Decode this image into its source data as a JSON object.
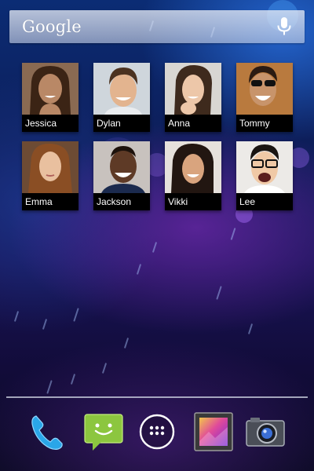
{
  "search": {
    "logo_text": "Google",
    "mic_icon": "microphone-icon"
  },
  "contacts": [
    {
      "name": "Jessica",
      "skin": "#b98866",
      "hair": "#3b2415",
      "bg": "#8a6a52"
    },
    {
      "name": "Dylan",
      "skin": "#e3b48f",
      "hair": "#4b3220",
      "bg": "#cfd6dc"
    },
    {
      "name": "Anna",
      "skin": "#edc7a9",
      "hair": "#3e2a1d",
      "bg": "#d8d6d2"
    },
    {
      "name": "Tommy",
      "skin": "#c8946b",
      "hair": "#2b1b12",
      "bg": "#b97a3e"
    },
    {
      "name": "Emma",
      "skin": "#e9c09f",
      "hair": "#8a4e24",
      "bg": "#6d4b34"
    },
    {
      "name": "Jackson",
      "skin": "#5e3a26",
      "hair": "#1d120c",
      "bg": "#c8c2be"
    },
    {
      "name": "Vikki",
      "skin": "#d9a47e",
      "hair": "#221611",
      "bg": "#e6e1dc"
    },
    {
      "name": "Lee",
      "skin": "#f0c9a6",
      "hair": "#1a1512",
      "bg": "#eceae7"
    }
  ],
  "dock": [
    {
      "name": "phone",
      "icon": "phone-icon"
    },
    {
      "name": "messaging",
      "icon": "messaging-icon"
    },
    {
      "name": "all-apps",
      "icon": "app-drawer-icon"
    },
    {
      "name": "gallery",
      "icon": "gallery-icon"
    },
    {
      "name": "camera",
      "icon": "camera-icon"
    }
  ],
  "colors": {
    "accent_blue": "#2aa6e8",
    "messaging_green": "#8cc63f"
  }
}
